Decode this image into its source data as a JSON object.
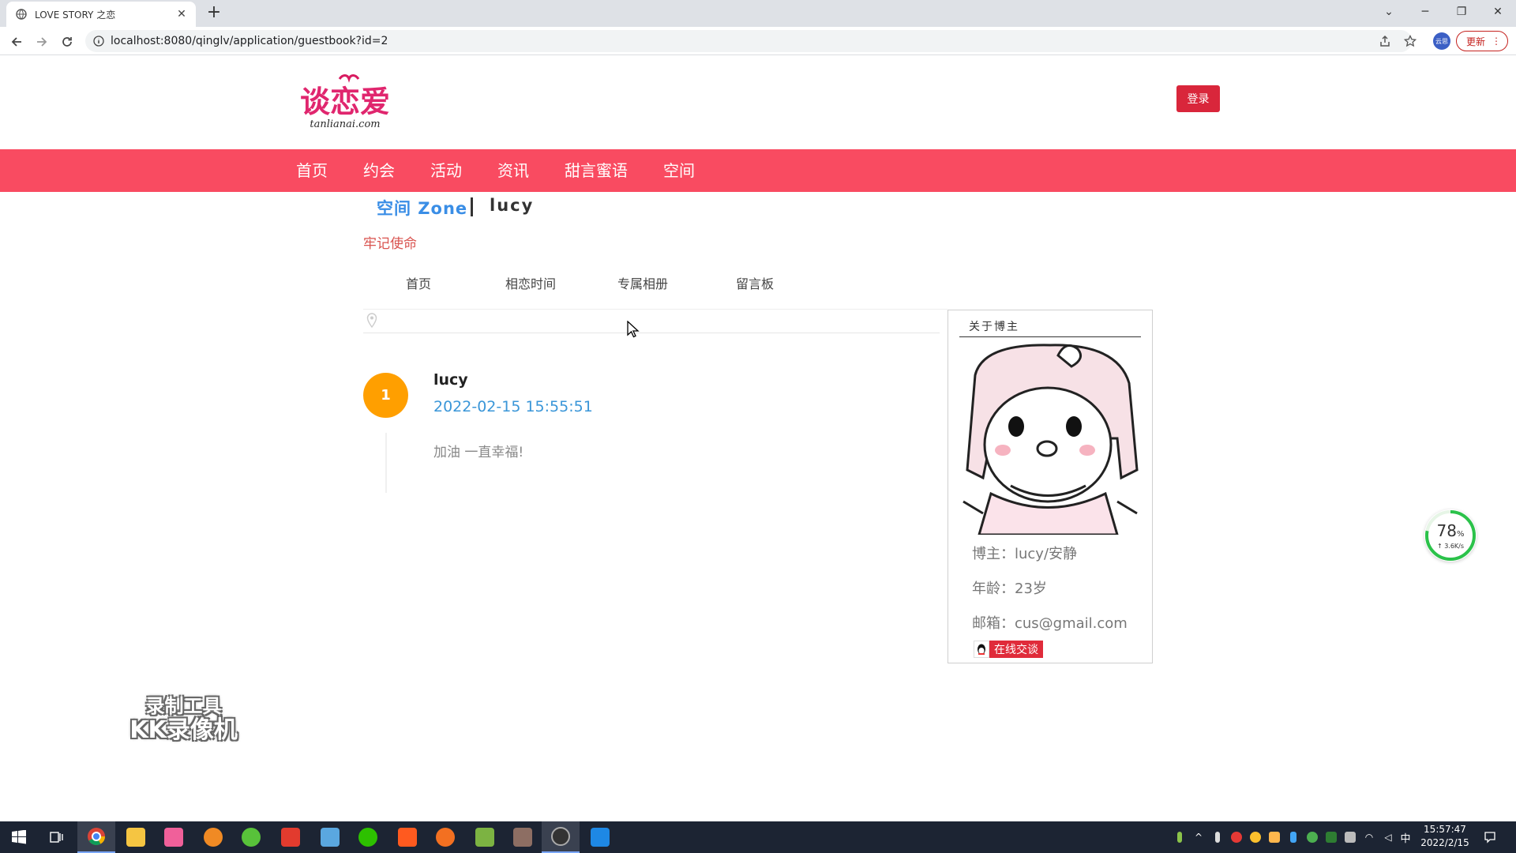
{
  "browser": {
    "tab_title": "LOVE STORY 之恋",
    "url": "localhost:8080/qinglv/application/guestbook?id=2",
    "profile_label": "云思",
    "update_label": "更新"
  },
  "site": {
    "logo_text": "谈恋爱",
    "logo_sub": "tanlianai.com",
    "login_label": "登录",
    "nav": [
      "首页",
      "约会",
      "活动",
      "资讯",
      "甜言蜜语",
      "空间"
    ]
  },
  "zone": {
    "title": "空间 Zone",
    "user": "lucy",
    "motto": "牢记使命",
    "subnav": [
      "首页",
      "相恋时间",
      "专属相册",
      "留言板"
    ]
  },
  "guestbook": {
    "entries": [
      {
        "index": "1",
        "author": "lucy",
        "time": "2022-02-15 15:55:51",
        "text": "加油 一直幸福!"
      }
    ]
  },
  "about": {
    "heading": "关于博主",
    "blogger": "博主：lucy/安静",
    "age": "年龄：23岁",
    "email": "邮箱：cus@gmail.com",
    "chat_label": "在线交谈"
  },
  "speed_widget": {
    "percent": "78",
    "percent_unit": "%",
    "rate": "↑ 3.6K/s",
    "percent_value": 78
  },
  "watermark": {
    "line1": "录制工具",
    "line2": "KK录像机"
  },
  "taskbar": {
    "time": "15:57:47",
    "date": "2022/2/15",
    "ime": "中"
  },
  "colors": {
    "nav_bg": "#f94b61",
    "login_bg": "#d9263b",
    "zone_blue": "#3a8ee6",
    "time_blue": "#3a96d8",
    "avatar_orange": "#ff9f00"
  }
}
